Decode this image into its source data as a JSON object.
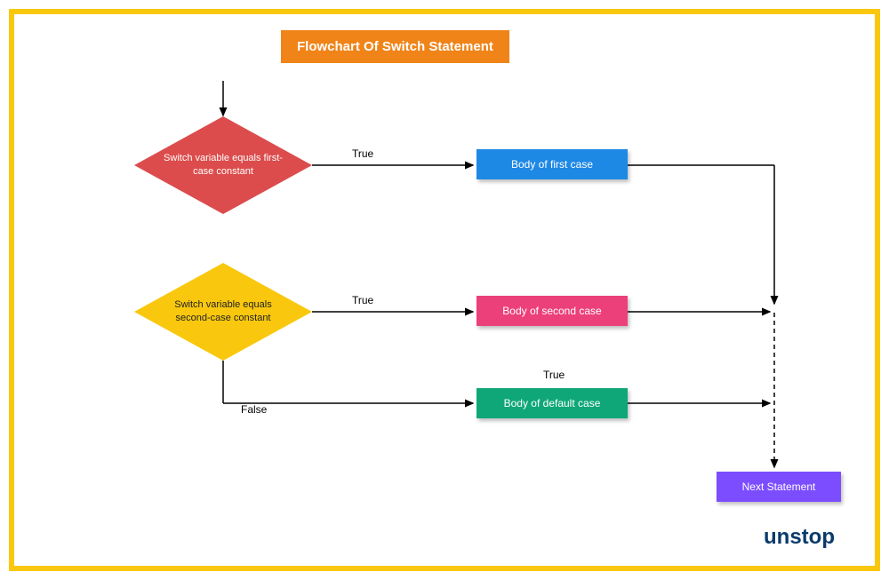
{
  "title": "Flowchart Of Switch Statement",
  "nodes": {
    "decision1": "Switch variable equals first-case constant",
    "decision2": "Switch variable equals second-case constant",
    "body1": "Body of first case",
    "body2": "Body of second case",
    "body3": "Body of default case",
    "next": "Next Statement"
  },
  "labels": {
    "true1": "True",
    "true2": "True",
    "true3": "True",
    "false": "False"
  },
  "logo": {
    "prefix": "un",
    "suffix": "stop"
  },
  "colors": {
    "border": "#F9C80E",
    "title_bg": "#F08419",
    "diamond_red": "#DC4C4C",
    "diamond_yellow": "#F9C80E",
    "rect_blue": "#1E88E5",
    "rect_pink": "#EC407A",
    "rect_green": "#0FA777",
    "rect_purple": "#7C4DFF",
    "logo": "#0A3A6B"
  }
}
